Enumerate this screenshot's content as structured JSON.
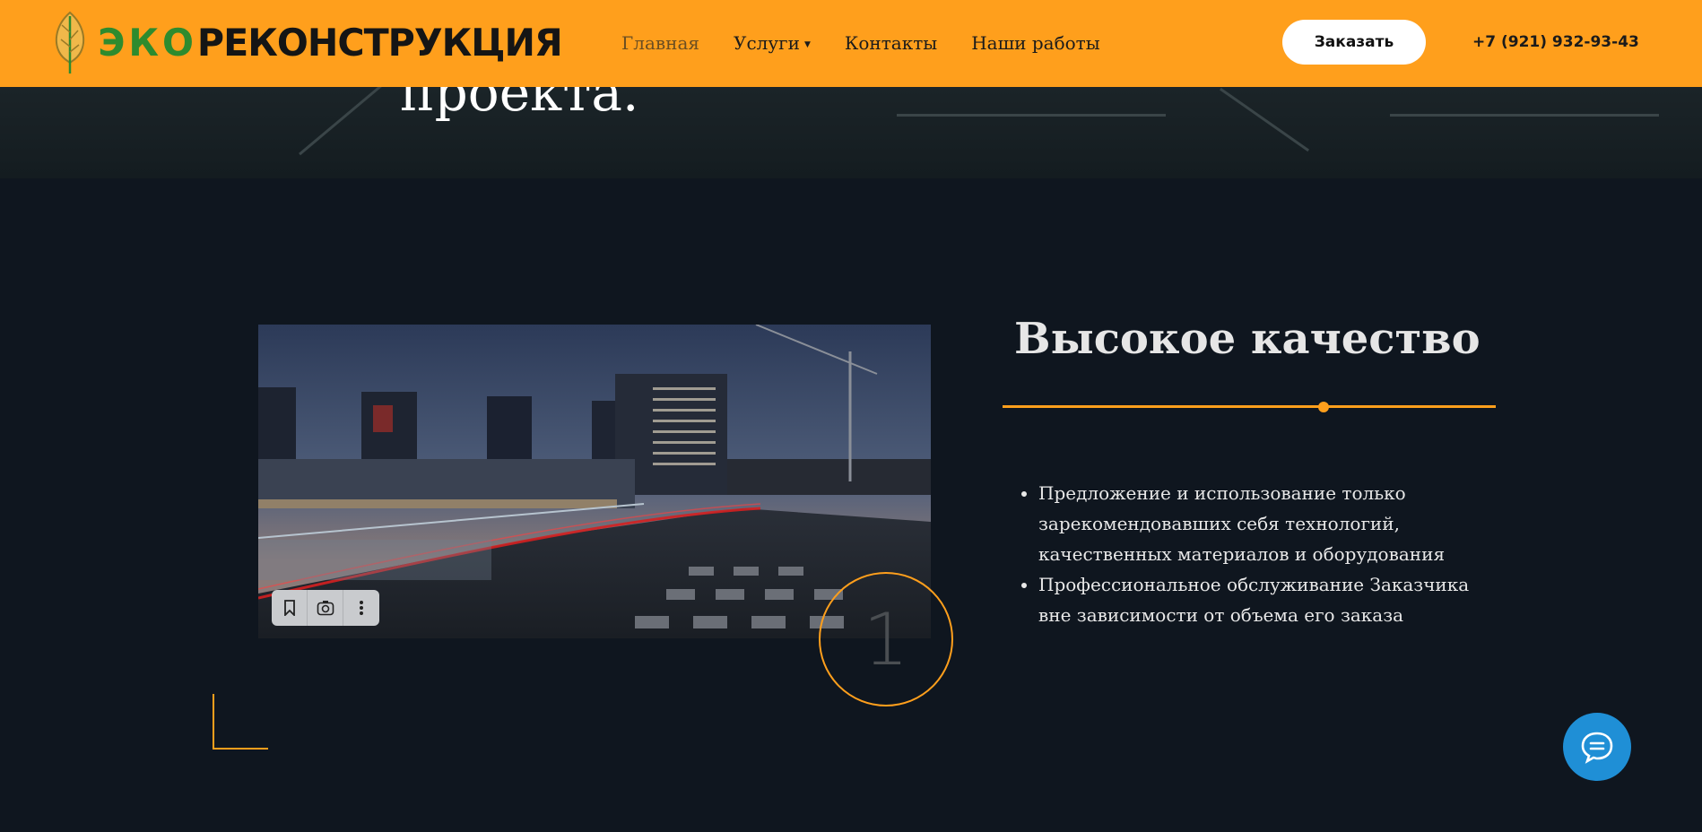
{
  "header": {
    "logo": {
      "eco": "ЭКО",
      "main": "РЕКОНСТРУКЦИЯ",
      "icon": "leaf-icon"
    },
    "nav": [
      {
        "label": "Главная",
        "active": true
      },
      {
        "label": "Услуги",
        "has_dropdown": true
      },
      {
        "label": "Контакты"
      },
      {
        "label": "Наши работы"
      }
    ],
    "order_label": "Заказать",
    "phone": "+7 (921) 932-93-43"
  },
  "hero": {
    "title": "проекта."
  },
  "feature": {
    "number": "1",
    "title": "Высокое качество",
    "items": [
      "Предложение и использование только зарекомендовавших себя технологий, качественных материалов и оборудования",
      "Профессиональное обслуживание Заказчика вне зависимости от объема его заказа"
    ],
    "image_toolbar": [
      "bookmark-icon",
      "lens-icon",
      "more-vertical-icon"
    ]
  },
  "chat": {
    "icon": "chat-bubble-icon"
  },
  "colors": {
    "accent": "#ff9f1c",
    "background": "#0f161f",
    "chat": "#1f8fd6",
    "logo_green": "#2e8b2e"
  }
}
